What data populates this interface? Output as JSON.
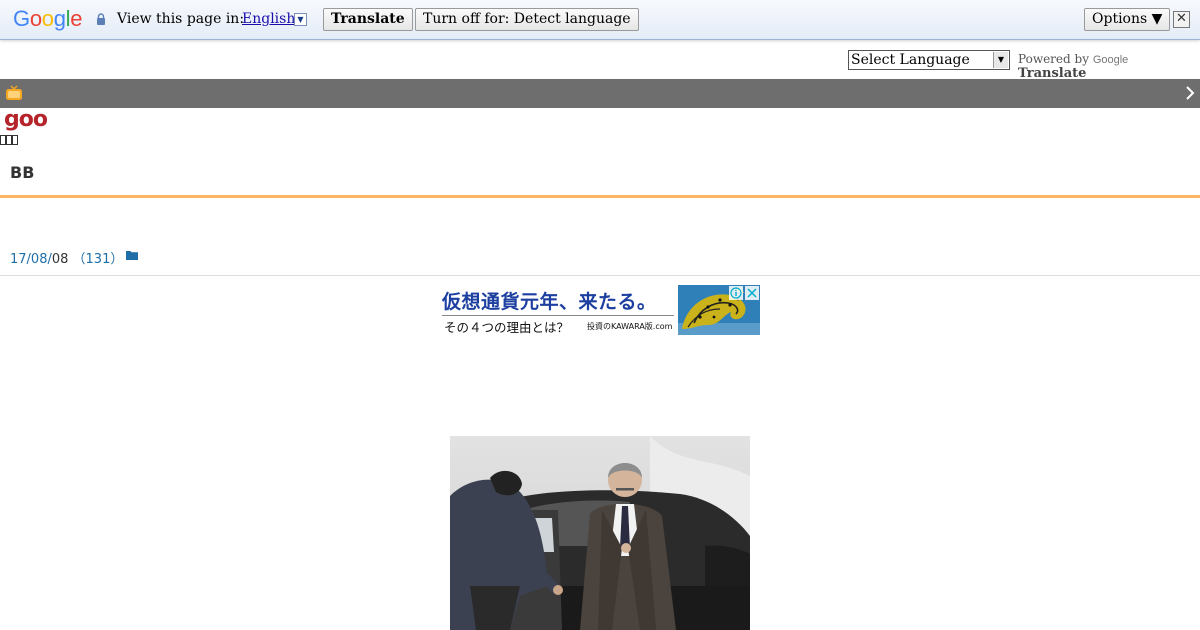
{
  "translate_bar": {
    "logo": "Google",
    "view_label": "View this page in:",
    "language": "English",
    "translate_button": "Translate",
    "turn_off_button": "Turn off for: Detect language",
    "options_button": "Options ▼",
    "close_label": "✕"
  },
  "language_widget": {
    "selected": "Select Language",
    "powered_by": "Powered by",
    "google": "Google",
    "translate": "Translate"
  },
  "header": {
    "site_logo": "goo",
    "blog_title": "BB"
  },
  "post": {
    "date_year": "17/08/",
    "date_day": "08",
    "count": "（131）"
  },
  "ad": {
    "headline": "仮想通貨元年、来たる。",
    "subline": "その４つの理由とは？",
    "source": "投資のKAWARA版.com"
  },
  "colors": {
    "accent_orange": "#fbb563",
    "goo_red": "#b5242a",
    "link_blue": "#1f6ea8",
    "header_gray": "#6e6e6e"
  }
}
